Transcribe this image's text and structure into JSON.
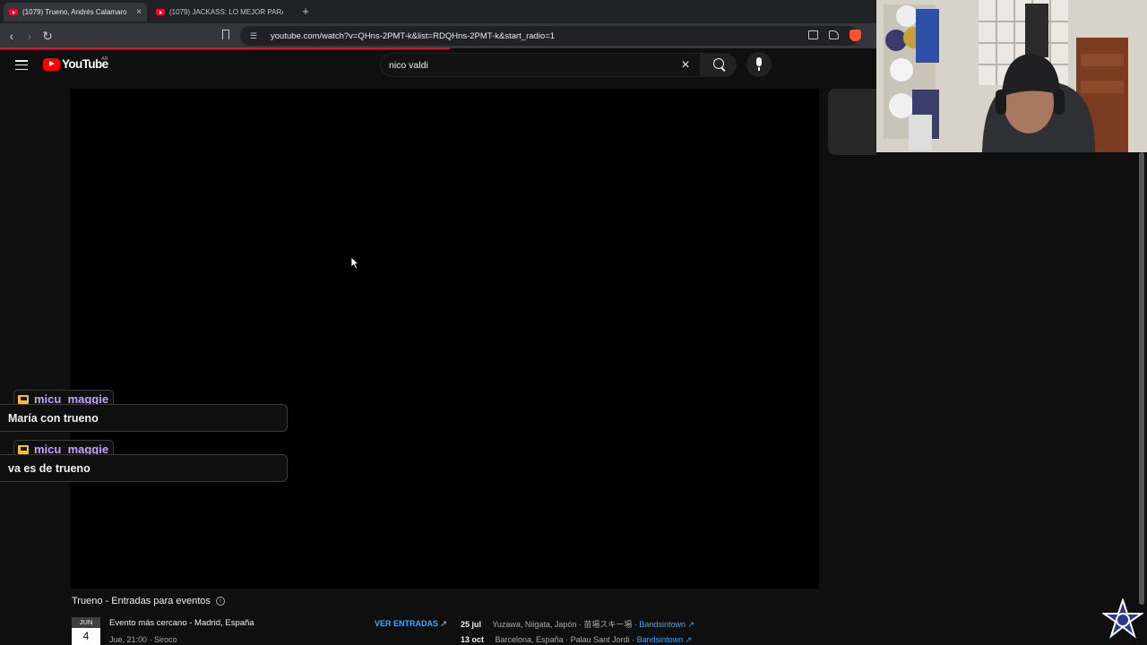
{
  "browser": {
    "tabs": [
      {
        "title": "(1079) Trueno, Andrés Calamaro",
        "active": true
      },
      {
        "title": "(1079) JACKASS: LO MEJOR PARA EL",
        "active": false
      }
    ],
    "close_glyph": "×",
    "new_tab_glyph": "+",
    "url": "youtube.com/watch?v=QHns-2PMT-k&list=RDQHns-2PMT-k&start_radio=1",
    "nav": {
      "back": "‹",
      "forward": "›",
      "reload": "↻"
    }
  },
  "youtube": {
    "logo_text": "YouTube",
    "country_code": "AR",
    "search": {
      "value": "nico valdi",
      "clear_glyph": "×"
    },
    "brand_color": "#ff0000"
  },
  "chat": [
    {
      "user": "micu_maggie",
      "message": "María con trueno"
    },
    {
      "user": "micu_maggie",
      "message": "va es de trueno"
    }
  ],
  "events": {
    "title": "Trueno - Entradas para eventos",
    "info_glyph": "i",
    "featured": {
      "month": "JUN",
      "day": "4",
      "headline": "Evento más cercano - Madrid, España",
      "details": "Jue, 21:00 · Siroco",
      "cta": "VER ENTRADAS ↗"
    },
    "list": [
      {
        "date": "25 jul",
        "place": "Yuzawa, Niigata, Japón · 苗場スキー場 · ",
        "source": "Bandsintown ↗"
      },
      {
        "date": "13 oct",
        "place": "Barcelona, España · Palau Sant Jordi · ",
        "source": "Bandsintown ↗"
      }
    ]
  },
  "icons": [
    "youtube-favicon",
    "bookmark-icon",
    "site-info-icon",
    "cast-icon",
    "share-icon",
    "brave-shield-icon",
    "menu-icon",
    "search-icon",
    "microphone-icon",
    "crown-icon",
    "info-icon",
    "star-logo-icon"
  ]
}
